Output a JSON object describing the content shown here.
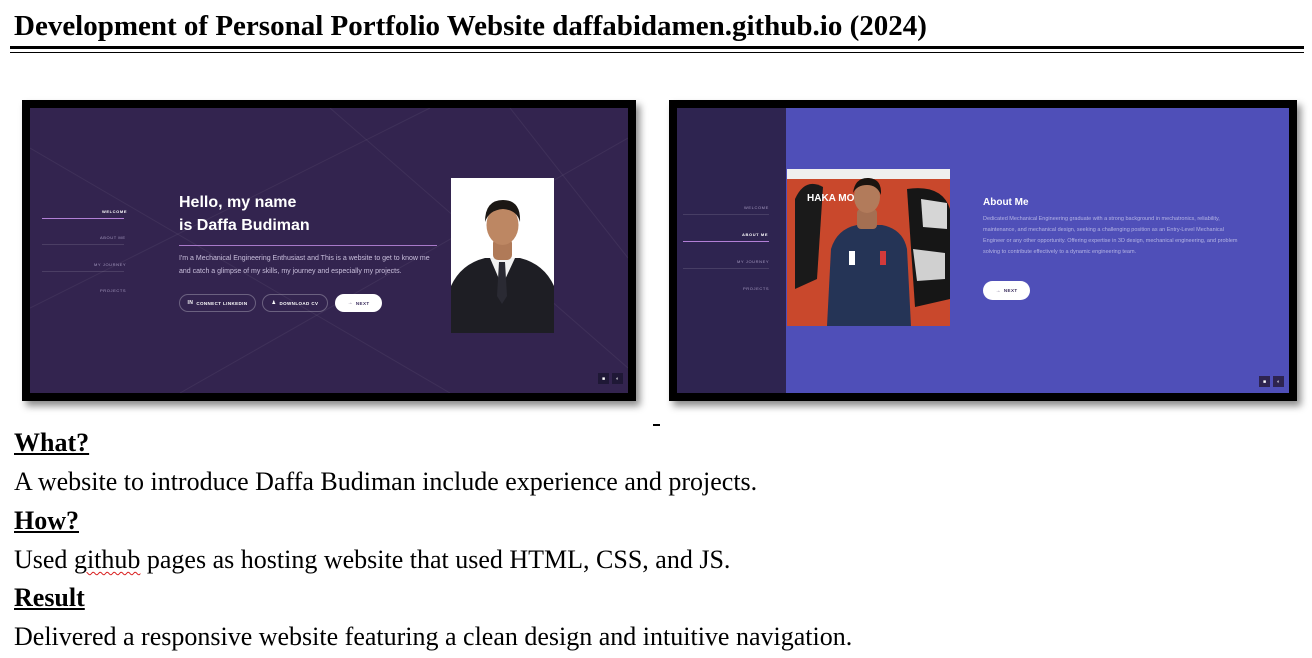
{
  "title": "Development of Personal Portfolio Website daffabidamen.github.io (2024)",
  "screenshot_home": {
    "nav": [
      "WELCOME",
      "ABOUT ME",
      "MY JOURNEY",
      "PROJECTS"
    ],
    "active_nav": "WELCOME",
    "heading_line1": "Hello, my name",
    "heading_line2": "is Daffa Budiman",
    "intro": "I'm a Mechanical Engineering Enthusiast and This is a website to get to know me and catch a glimpse of my skills, my journey and especially my projects.",
    "buttons": [
      "CONNECT LINKEDIN",
      "DOWNLOAD CV",
      "NEXT"
    ],
    "colors": {
      "background": "#33244f",
      "accent": "#a879c9"
    }
  },
  "screenshot_about": {
    "nav": [
      "WELCOME",
      "ABOUT ME",
      "MY JOURNEY",
      "PROJECTS"
    ],
    "active_nav": "ABOUT ME",
    "heading": "About Me",
    "text": "Dedicated Mechanical Engineering graduate with a strong background in mechatronics, reliability, maintenance, and mechanical design, seeking a challenging position as an Entry-Level Mechanical Engineer or any other opportunity. Offering expertise in 3D design, mechanical engineering, and problem solving to contribute effectively to a dynamic engineering team.",
    "button": "NEXT",
    "photo_sign_text": "HAKA MOTO",
    "colors": {
      "background": "#4f4fb8",
      "sidebar": "#2e2450"
    }
  },
  "sections": {
    "what_heading": "What?",
    "what_text": "A website to introduce Daffa Budiman include experience and projects.",
    "how_heading": "How?",
    "how_text_before": "Used ",
    "how_text_misspelled": "github",
    "how_text_after": " pages as hosting website that used HTML, CSS, and JS.",
    "result_heading": "Result",
    "result_text": "Delivered a responsive website featuring a clean design and intuitive navigation."
  }
}
